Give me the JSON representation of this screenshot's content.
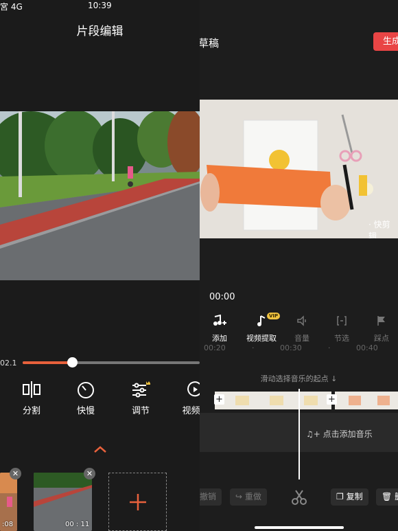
{
  "left": {
    "status": {
      "carrier": "宮 4G",
      "time": "10:39"
    },
    "title": "片段编辑",
    "time_label": "02.1",
    "playback_progress": 0.28,
    "tools": [
      {
        "label": "分割",
        "icon": "split-icon"
      },
      {
        "label": "快慢",
        "icon": "speed-icon"
      },
      {
        "label": "调节",
        "icon": "adjust-icon"
      },
      {
        "label": "视频倒",
        "icon": "reverse-icon"
      }
    ],
    "clips": [
      {
        "duration": ":08"
      },
      {
        "duration": "00 : 11"
      }
    ]
  },
  "right": {
    "draft_label": "草稿",
    "generate_button": "生成",
    "watermark": "· 快剪辑",
    "time_display": "00:00",
    "tools": [
      {
        "label": "添加",
        "icon": "music-add-icon"
      },
      {
        "label": "视频提取",
        "icon": "music-note-icon",
        "badge": "VIP"
      },
      {
        "label": "音量",
        "icon": "volume-icon"
      },
      {
        "label": "节选",
        "icon": "excerpt-icon"
      },
      {
        "label": "踩点",
        "icon": "flag-icon"
      }
    ],
    "ruler": [
      "00:20",
      "00:30",
      "00:40"
    ],
    "hint": "滑动选择音乐的起点 ↓",
    "add_music": "点击添加音乐",
    "bottom": {
      "undo": "撤销",
      "redo": "重做",
      "copy": "复制",
      "delete": "删"
    }
  },
  "colors": {
    "accent": "#e8613c",
    "generate": "#e94545",
    "vip": "#f0c340",
    "background": "#1b1b1b"
  }
}
